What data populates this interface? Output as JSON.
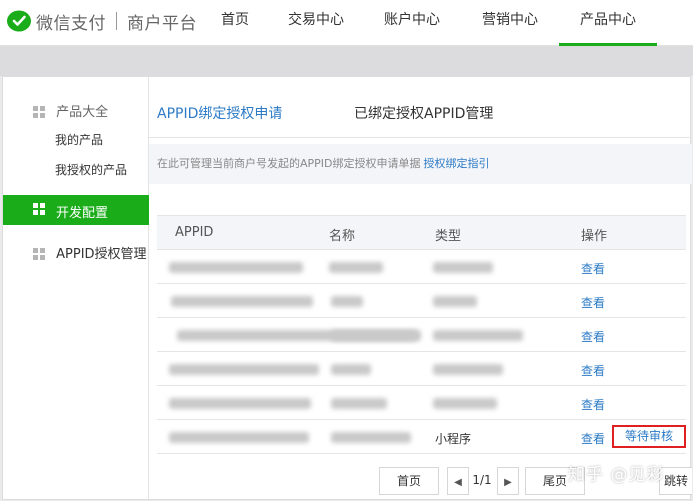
{
  "header": {
    "brand": "微信支付",
    "platform": "商户平台",
    "nav": [
      {
        "label": "首页"
      },
      {
        "label": "交易中心"
      },
      {
        "label": "账户中心"
      },
      {
        "label": "营销中心"
      },
      {
        "label": "产品中心",
        "active": true
      }
    ]
  },
  "sidebar": {
    "group1_title": "产品大全",
    "group1_items": [
      {
        "label": "我的产品"
      },
      {
        "label": "我授权的产品"
      }
    ],
    "active_item": "开发配置",
    "group2_title": "APPID授权管理"
  },
  "tabs": {
    "tab1": "APPID绑定授权申请",
    "tab2": "已绑定授权APPID管理"
  },
  "hint": {
    "text": "在此可管理当前商户号发起的APPID绑定授权申请单据",
    "link": "授权绑定指引"
  },
  "table": {
    "headers": [
      "APPID",
      "名称",
      "类型",
      "操作"
    ],
    "rows": [
      {
        "type": "",
        "action": "查看"
      },
      {
        "type": "",
        "action": "查看"
      },
      {
        "type": "",
        "action": "查看"
      },
      {
        "type": "",
        "action": "查看"
      },
      {
        "type": "",
        "action": "查看"
      },
      {
        "type": "小程序",
        "action": "查看",
        "extra_action": "等待审核"
      }
    ]
  },
  "pagination": {
    "first": "首页",
    "prev_icon": "chevron-left-icon",
    "page_indicator": "1/1",
    "next_icon": "chevron-right-icon",
    "last": "尾页",
    "jump": "跳转"
  },
  "watermark": "知乎 @见彩",
  "colors": {
    "accent_green": "#1aad19",
    "link_blue": "#2d7bc6",
    "highlight_red": "#e02020"
  }
}
